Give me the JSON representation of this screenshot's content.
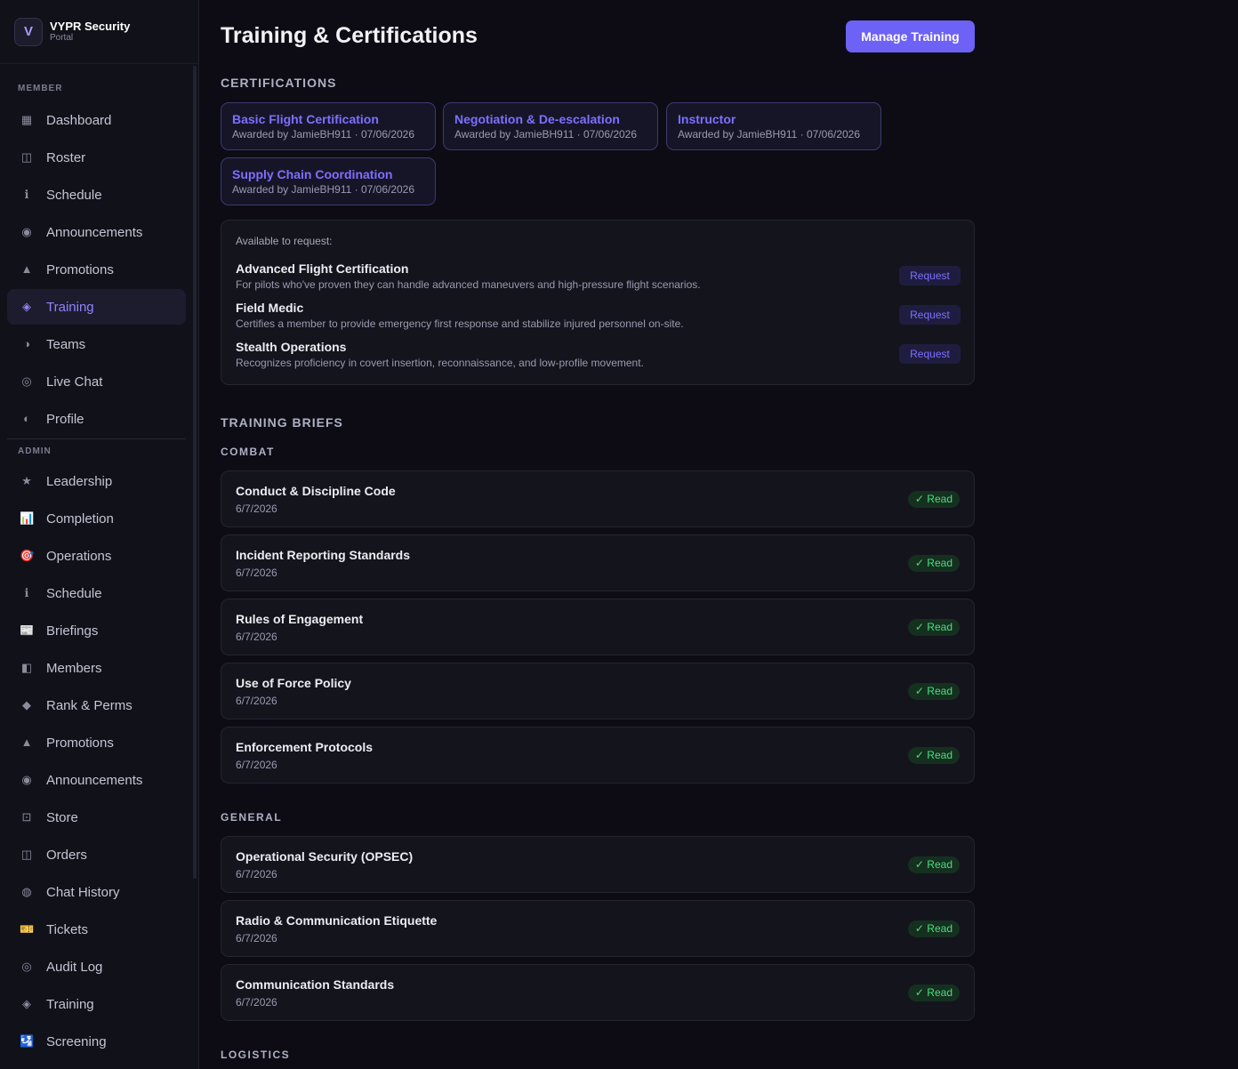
{
  "brand": {
    "initial": "V",
    "name": "VYPR Security",
    "subtitle": "Portal"
  },
  "sidebar": {
    "member_title": "MEMBER",
    "member_items": [
      {
        "label": "Dashboard",
        "icon": "▦",
        "icon_name": "dashboard-icon"
      },
      {
        "label": "Roster",
        "icon": "◫",
        "icon_name": "roster-icon"
      },
      {
        "label": "Schedule",
        "icon": "ℹ",
        "icon_name": "schedule-icon"
      },
      {
        "label": "Announcements",
        "icon": "◉",
        "icon_name": "announcements-icon"
      },
      {
        "label": "Promotions",
        "icon": "▲",
        "icon_name": "promotions-icon"
      },
      {
        "label": "Training",
        "icon": "◈",
        "icon_name": "training-icon",
        "active": true
      },
      {
        "label": "Teams",
        "icon": "◑",
        "icon_name": "teams-icon"
      },
      {
        "label": "Live Chat",
        "icon": "◎",
        "icon_name": "live-chat-icon"
      },
      {
        "label": "Profile",
        "icon": "◐",
        "icon_name": "profile-icon"
      }
    ],
    "admin_title": "ADMIN",
    "admin_items": [
      {
        "label": "Leadership",
        "icon": "★",
        "icon_name": "leadership-icon"
      },
      {
        "label": "Completion",
        "icon": "📊",
        "icon_name": "completion-chart-icon"
      },
      {
        "label": "Operations",
        "icon": "🎯",
        "icon_name": "operations-target-icon"
      },
      {
        "label": "Schedule",
        "icon": "ℹ",
        "icon_name": "schedule-icon"
      },
      {
        "label": "Briefings",
        "icon": "📰",
        "icon_name": "briefings-icon"
      },
      {
        "label": "Members",
        "icon": "◧",
        "icon_name": "members-icon"
      },
      {
        "label": "Rank & Perms",
        "icon": "◆",
        "icon_name": "rank-perms-icon"
      },
      {
        "label": "Promotions",
        "icon": "▲",
        "icon_name": "promotions-icon"
      },
      {
        "label": "Announcements",
        "icon": "◉",
        "icon_name": "announcements-icon"
      },
      {
        "label": "Store",
        "icon": "⊡",
        "icon_name": "store-icon"
      },
      {
        "label": "Orders",
        "icon": "◫",
        "icon_name": "orders-icon"
      },
      {
        "label": "Chat History",
        "icon": "◍",
        "icon_name": "chat-history-icon"
      },
      {
        "label": "Tickets",
        "icon": "🎫",
        "icon_name": "tickets-icon"
      },
      {
        "label": "Audit Log",
        "icon": "◎",
        "icon_name": "audit-log-icon"
      },
      {
        "label": "Training",
        "icon": "◈",
        "icon_name": "training-icon"
      },
      {
        "label": "Screening",
        "icon": "🛂",
        "icon_name": "screening-icon"
      }
    ]
  },
  "header": {
    "title": "Training & Certifications",
    "manage_label": "Manage Training"
  },
  "certifications": {
    "heading": "CERTIFICATIONS",
    "items": [
      {
        "title": "Basic Flight Certification",
        "meta": "Awarded by JamieBH911 · 07/06/2026"
      },
      {
        "title": "Negotiation & De-escalation",
        "meta": "Awarded by JamieBH911 · 07/06/2026"
      },
      {
        "title": "Instructor",
        "meta": "Awarded by JamieBH911 · 07/06/2026"
      },
      {
        "title": "Supply Chain Coordination",
        "meta": "Awarded by JamieBH911 · 07/06/2026"
      }
    ]
  },
  "available": {
    "label": "Available to request:",
    "request_label": "Request",
    "items": [
      {
        "name": "Advanced Flight Certification",
        "desc": "For pilots who've proven they can handle advanced maneuvers and high-pressure flight scenarios."
      },
      {
        "name": "Field Medic",
        "desc": "Certifies a member to provide emergency first response and stabilize injured personnel on-site."
      },
      {
        "name": "Stealth Operations",
        "desc": "Recognizes proficiency in covert insertion, reconnaissance, and low-profile movement."
      }
    ]
  },
  "briefs": {
    "heading": "TRAINING BRIEFS",
    "read_label": "✓ Read",
    "groups": [
      {
        "name": "COMBAT",
        "items": [
          {
            "title": "Conduct & Discipline Code",
            "date": "6/7/2026"
          },
          {
            "title": "Incident Reporting Standards",
            "date": "6/7/2026"
          },
          {
            "title": "Rules of Engagement",
            "date": "6/7/2026"
          },
          {
            "title": "Use of Force Policy",
            "date": "6/7/2026"
          },
          {
            "title": "Enforcement Protocols",
            "date": "6/7/2026"
          }
        ]
      },
      {
        "name": "GENERAL",
        "items": [
          {
            "title": "Operational Security (OPSEC)",
            "date": "6/7/2026"
          },
          {
            "title": "Radio & Communication Etiquette",
            "date": "6/7/2026"
          },
          {
            "title": "Communication Standards",
            "date": "6/7/2026"
          }
        ]
      },
      {
        "name": "LOGISTICS",
        "items": []
      }
    ]
  },
  "colors": {
    "accent": "#6e61f5",
    "accent_text": "#7d70ff",
    "read_green": "#4ade80",
    "background": "#0d0c14"
  }
}
